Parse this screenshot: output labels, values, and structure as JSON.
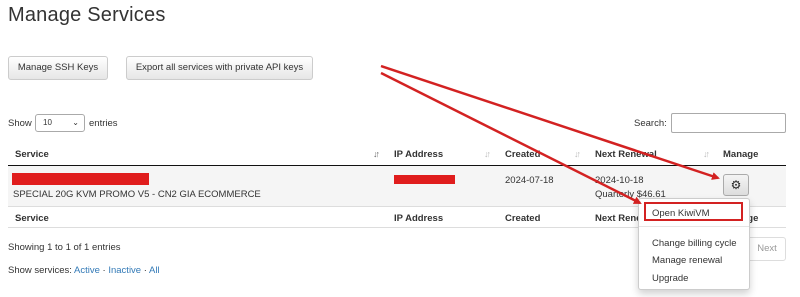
{
  "page": {
    "title": "Manage Services"
  },
  "toolbar": {
    "ssh_label": "Manage SSH Keys",
    "export_label": "Export all services with private API keys"
  },
  "table_controls": {
    "show_label": "Show",
    "entries_value": "10",
    "entries_suffix": "entries",
    "search_label": "Search:",
    "search_value": ""
  },
  "table": {
    "columns": [
      "Service",
      "IP Address",
      "Created",
      "Next Renewal",
      "Manage"
    ],
    "footer_columns": [
      "Service",
      "IP Address",
      "Created",
      "Next Renewal",
      "Manage"
    ],
    "rows": [
      {
        "service_name": "SPECIAL 20G KVM PROMO V5 - CN2 GIA ECOMMERCE",
        "created": "2024-07-18",
        "next_renewal": "2024-10-18",
        "renewal_price": "Quarterly $46.61"
      }
    ]
  },
  "footer": {
    "info": "Showing 1 to 1 of 1 entries",
    "next_label": "Next",
    "show_services_label": "Show services:",
    "filter_active": "Active",
    "filter_inactive": "Inactive",
    "filter_all": "All",
    "separator": " · "
  },
  "manage_menu": {
    "items": [
      "Open KiwiVM",
      "Change billing cycle",
      "Manage renewal",
      "Upgrade"
    ]
  },
  "colors": {
    "annotation_red": "#d32222",
    "redaction_red": "#e01d1d",
    "link_blue": "#337ab7"
  },
  "icons": {
    "manage_button": "gear-icon",
    "entries_select": "chevron-down-icon"
  }
}
